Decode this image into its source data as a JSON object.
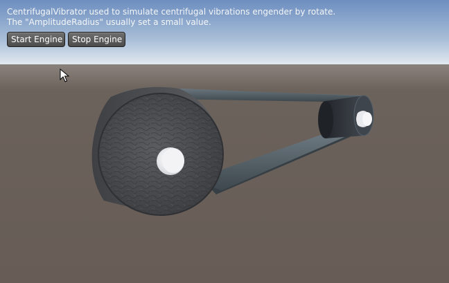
{
  "info": {
    "line1": "CentrifugalVibrator used to simulate centrifugal vibrations engender by rotate.",
    "line2": "The \"AmplitudeRadius\" usually set a small value."
  },
  "buttons": {
    "start_label": "Start Engine",
    "stop_label": "Stop Engine"
  },
  "colors": {
    "sky_top": "#6d8ec0",
    "horizon": "#e7ecf1",
    "ground": "#685d57",
    "belt": "#4a545a",
    "flywheel": "#4d4e51",
    "pulley": "#2f3339",
    "shaft": "#f0f0f2"
  }
}
